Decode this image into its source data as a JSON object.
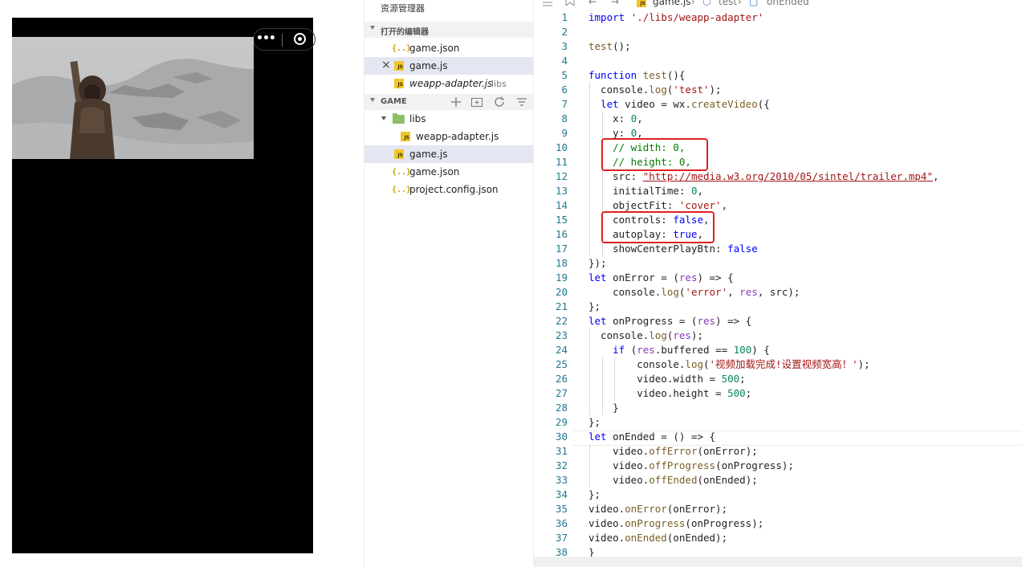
{
  "simulator": {
    "menu_icon": "more-dots-icon",
    "close_icon": "record-circle-icon"
  },
  "explorer": {
    "title": "资源管理器",
    "open_editors": {
      "header": "打开的编辑器",
      "items": [
        {
          "name": "game.json",
          "path": "",
          "icon": "json-file-icon"
        },
        {
          "name": "game.js",
          "path": "",
          "icon": "js-file-icon",
          "close": "×"
        },
        {
          "name": "weapp-adapter.js",
          "path": "libs",
          "icon": "js-file-icon"
        }
      ]
    },
    "project": {
      "header": "GAME",
      "toolbar_icons": [
        "new-file-icon",
        "new-folder-icon",
        "refresh-icon",
        "collapse-all-icon"
      ],
      "tree": [
        {
          "name": "libs",
          "type": "folder",
          "icon": "folder-open-icon"
        },
        {
          "name": "weapp-adapter.js",
          "type": "js",
          "icon": "js-file-icon"
        },
        {
          "name": "game.js",
          "type": "js",
          "icon": "js-file-icon"
        },
        {
          "name": "game.json",
          "type": "json",
          "icon": "json-file-icon"
        },
        {
          "name": "project.config.json",
          "type": "json",
          "icon": "json-file-icon"
        }
      ]
    }
  },
  "editor": {
    "breadcrumb": {
      "file": "game.js",
      "sep": "›",
      "scope": "test",
      "symbol": "onEnded"
    },
    "colors": {
      "keyword": "#0000ff",
      "string": "#a31515",
      "number": "#098658",
      "comment": "#008000",
      "line_number": "#237893",
      "highlight_box": "#e02020"
    },
    "lines": [
      "import './libs/weapp-adapter'",
      "",
      "test();",
      "",
      "function test(){",
      "  console.log('test');",
      "  let video = wx.createVideo({",
      "    x: 0,",
      "    y: 0,",
      "    // width: 0,",
      "    // height: 0,",
      "    src: \"http://media.w3.org/2010/05/sintel/trailer.mp4\",",
      "    initialTime: 0,",
      "    objectFit: 'cover',",
      "    controls: false,",
      "    autoplay: true,",
      "    showCenterPlayBtn: false",
      "});",
      "let onError = (res) => {",
      "    console.log('error', res, src);",
      "};",
      "let onProgress = (res) => {",
      "  console.log(res);",
      "    if (res.buffered == 100) {",
      "        console.log('视频加载完成!设置视频宽高！');",
      "        video.width = 500;",
      "        video.height = 500;",
      "    }",
      "};",
      "let onEnded = () => {",
      "    video.offError(onError);",
      "    video.offProgress(onProgress);",
      "    video.offEnded(onEnded);",
      "};",
      "video.onError(onError);",
      "video.onProgress(onProgress);",
      "video.onEnded(onEnded);",
      "}"
    ]
  }
}
